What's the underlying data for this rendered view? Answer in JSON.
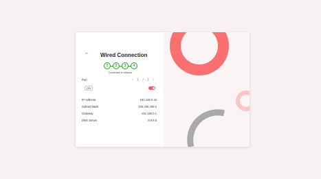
{
  "dialog": {
    "back_label": "←",
    "title": "Wired Connection",
    "steps": [
      "1",
      "2",
      "3",
      "4"
    ],
    "status_text": "Connected to network",
    "section_label": "Port",
    "nav_page": "1 / 1",
    "toggle_tag": "ON",
    "details": [
      {
        "label": "IP Address",
        "value": "192.168.0.15"
      },
      {
        "label": "Subnet Mask",
        "value": "255.255.255.0"
      },
      {
        "label": "Gateway",
        "value": "192.168.0.1"
      },
      {
        "label": "DNS Server",
        "value": "8.8.8.8"
      }
    ]
  },
  "colors": {
    "accent": "#f25c5c",
    "step_green": "#3c9a3c",
    "ring_top": "#fa6f6f",
    "ring_light": "#f9c4c4",
    "arc_gray": "#a9a9a9"
  }
}
